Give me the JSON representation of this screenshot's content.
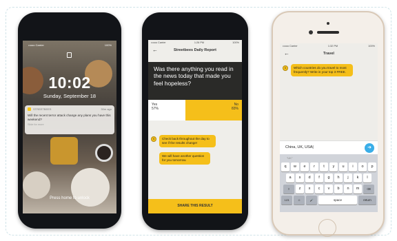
{
  "phone1": {
    "status": {
      "carrier": "••ooo Carrier",
      "battery": "100%"
    },
    "lock_time": "10:02",
    "lock_date": "Sunday, September 18",
    "notification": {
      "app": "STREETBEES",
      "time": "30m ago",
      "body": "Will the recent terror attack change any plans you have this weekend?",
      "sub": "Slide for more"
    },
    "unlock_hint": "Press home to unlock"
  },
  "phone2": {
    "status": {
      "carrier": "••ooo Carrier",
      "time": "1:26 PM",
      "battery": "100%"
    },
    "nav_title": "Streetbees Daily Report",
    "question": "Was there anything you read in the news today that made you feel hopeless?",
    "poll": {
      "yes_label": "Yes",
      "yes_value": "57%",
      "no_label": "No",
      "no_value": "83%"
    },
    "avatar": "S",
    "messages": [
      "Check back throughout the day to see if the results change!",
      "We will have another question for you tomorrow."
    ],
    "share_label": "SHARE THIS RESULT"
  },
  "phone3": {
    "status": {
      "carrier": "••ooo Carrier",
      "time": "1:32 PM",
      "battery": "100%"
    },
    "nav_title": "Travel",
    "avatar": "S",
    "message": "Which countries do you travel to most frequently? Write in your top 3 FREE.",
    "input_value": "China, UK, USA|",
    "suggestion": "\"UK\"",
    "keyboard": {
      "row1": [
        "q",
        "w",
        "e",
        "r",
        "t",
        "y",
        "u",
        "i",
        "o",
        "p"
      ],
      "row2": [
        "a",
        "s",
        "d",
        "f",
        "g",
        "h",
        "j",
        "k",
        "l"
      ],
      "row3": [
        "z",
        "x",
        "c",
        "v",
        "b",
        "n",
        "m"
      ],
      "shift": "⇧",
      "delete": "⌫",
      "numbers": "123",
      "emoji": "☺",
      "mic": "🎤",
      "space": "space",
      "return": "return"
    }
  },
  "colors": {
    "accent_yellow": "#f5bf1a",
    "send_blue": "#3aaee8",
    "dark": "#2a2a28"
  }
}
